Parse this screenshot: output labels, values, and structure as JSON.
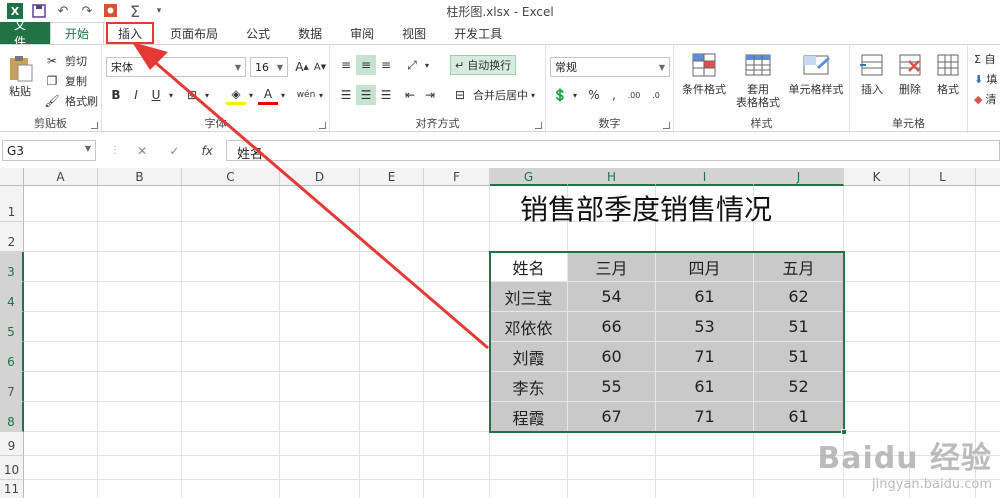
{
  "window": {
    "title": "柱形图.xlsx - Excel"
  },
  "tabs": [
    {
      "label": "文件"
    },
    {
      "label": "开始"
    },
    {
      "label": "插入"
    },
    {
      "label": "页面布局"
    },
    {
      "label": "公式"
    },
    {
      "label": "数据"
    },
    {
      "label": "审阅"
    },
    {
      "label": "视图"
    },
    {
      "label": "开发工具"
    }
  ],
  "ribbon": {
    "clipboard": {
      "paste": "粘贴",
      "cut": "剪切",
      "copy": "复制",
      "format_painter": "格式刷",
      "label": "剪贴板"
    },
    "font": {
      "name": "宋体",
      "size": "16",
      "bold": "B",
      "italic": "I",
      "underline": "U",
      "label": "字体"
    },
    "alignment": {
      "wrap": "自动换行",
      "merge": "合并后居中",
      "label": "对齐方式"
    },
    "number": {
      "format": "常规",
      "label": "数字"
    },
    "styles": {
      "conditional": "条件格式",
      "table": "套用\n表格格式",
      "cell_styles": "单元格样式",
      "label": "样式"
    },
    "cells": {
      "insert": "插入",
      "delete": "删除",
      "format": "格式",
      "label": "单元格"
    },
    "editing": {
      "sum": "Σ 自",
      "fill": "填",
      "clear": "清"
    }
  },
  "formula_bar": {
    "name_box": "G3",
    "fx": "fx",
    "value": "姓名"
  },
  "sheet": {
    "columns": [
      "A",
      "B",
      "C",
      "D",
      "E",
      "F",
      "G",
      "H",
      "I",
      "J",
      "K",
      "L"
    ],
    "rows": [
      "1",
      "2",
      "3",
      "4",
      "5",
      "6",
      "7",
      "8",
      "9",
      "10",
      "11"
    ],
    "title": "销售部季度销售情况",
    "header": [
      "姓名",
      "三月",
      "四月",
      "五月"
    ],
    "data": [
      [
        "刘三宝",
        "54",
        "61",
        "62"
      ],
      [
        "邓依依",
        "66",
        "53",
        "51"
      ],
      [
        "刘霞",
        "60",
        "71",
        "51"
      ],
      [
        "李东",
        "55",
        "61",
        "52"
      ],
      [
        "程霞",
        "67",
        "71",
        "61"
      ]
    ]
  },
  "watermark": {
    "brand": "Baidu 经验",
    "url": "jingyan.baidu.com"
  }
}
